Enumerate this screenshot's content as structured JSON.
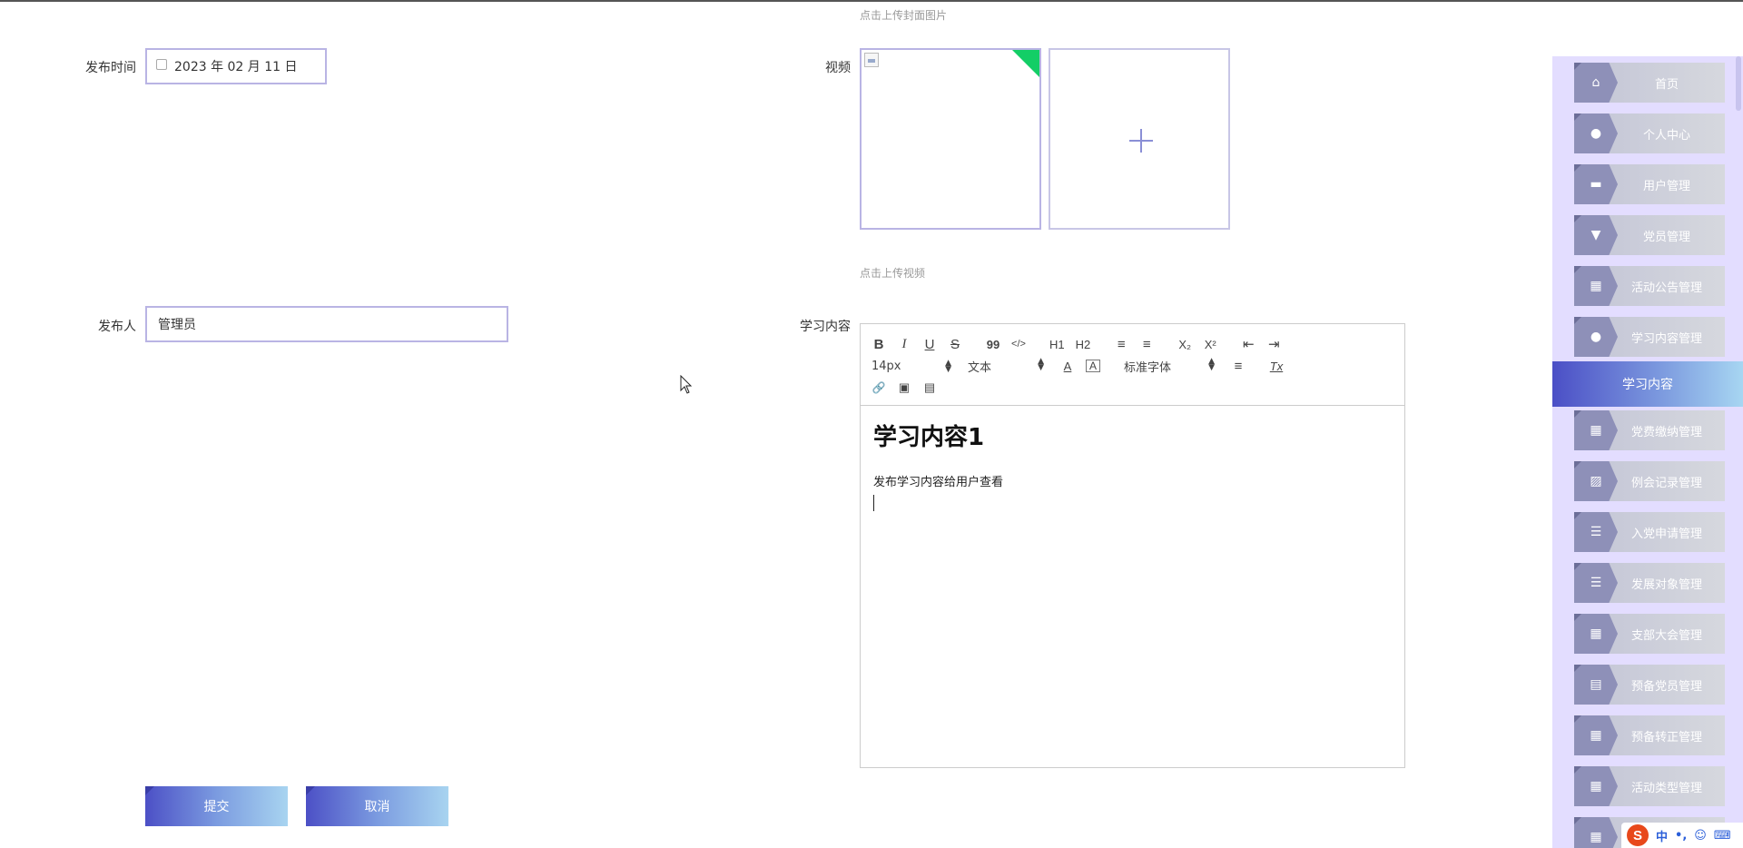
{
  "form": {
    "cover_hint": "点击上传封面图片",
    "publish_time_label": "发布时间",
    "publish_time_value": "2023 年 02 月 11 日",
    "video_label": "视频",
    "video_hint": "点击上传视频",
    "publisher_label": "发布人",
    "publisher_value": "管理员",
    "content_label": "学习内容",
    "submit_label": "提交",
    "cancel_label": "取消"
  },
  "editor": {
    "toolbar": {
      "bold": "B",
      "italic": "I",
      "underline": "U",
      "strike": "S",
      "blockquote": "99",
      "code": "</>",
      "h1": "H1",
      "h2": "H2",
      "ordered_list": "≡",
      "bullet_list": "≡",
      "subscript": "X₂",
      "superscript": "X²",
      "outdent": "⇤",
      "indent": "⇥",
      "font_size": "14px",
      "text_style": "文本",
      "color": "A",
      "background": "A",
      "font_family": "标准字体",
      "align": "≡",
      "clean": "Tx",
      "link": "🔗",
      "image": "▣",
      "video": "▤"
    },
    "heading": "学习内容1",
    "paragraph": "发布学习内容给用户查看"
  },
  "sidebar": {
    "items": [
      {
        "label": "首页",
        "icon": "home-icon",
        "glyph": "⌂"
      },
      {
        "label": "个人中心",
        "icon": "user-icon",
        "glyph": "●"
      },
      {
        "label": "用户管理",
        "icon": "briefcase-icon",
        "glyph": "▬"
      },
      {
        "label": "党员管理",
        "icon": "pin-icon",
        "glyph": "▼"
      },
      {
        "label": "活动公告管理",
        "icon": "grid-icon",
        "glyph": "▦"
      },
      {
        "label": "学习内容管理",
        "icon": "bulb-icon",
        "glyph": "●"
      },
      {
        "label": "党费缴纳管理",
        "icon": "grid-icon",
        "glyph": "▦"
      },
      {
        "label": "例会记录管理",
        "icon": "chart-icon",
        "glyph": "▨"
      },
      {
        "label": "入党申请管理",
        "icon": "list-icon",
        "glyph": "☰"
      },
      {
        "label": "发展对象管理",
        "icon": "list-icon",
        "glyph": "☰"
      },
      {
        "label": "支部大会管理",
        "icon": "grid-icon",
        "glyph": "▦"
      },
      {
        "label": "预备党员管理",
        "icon": "clipboard-icon",
        "glyph": "▤"
      },
      {
        "label": "预备转正管理",
        "icon": "table-icon",
        "glyph": "▦"
      },
      {
        "label": "活动类型管理",
        "icon": "grid-icon",
        "glyph": "▦"
      },
      {
        "label": "",
        "icon": "grid-icon",
        "glyph": "▦"
      }
    ],
    "active_label": "学习内容"
  },
  "ime": {
    "logo": "S",
    "lang": "中",
    "punct": "•,",
    "emoji": "☺",
    "keyboard": "⌨"
  },
  "colors": {
    "accent": "#4c50c6",
    "sidebar_bg": "#e3ddff",
    "field_border": "#b9b4e4",
    "success": "#13ce66"
  }
}
